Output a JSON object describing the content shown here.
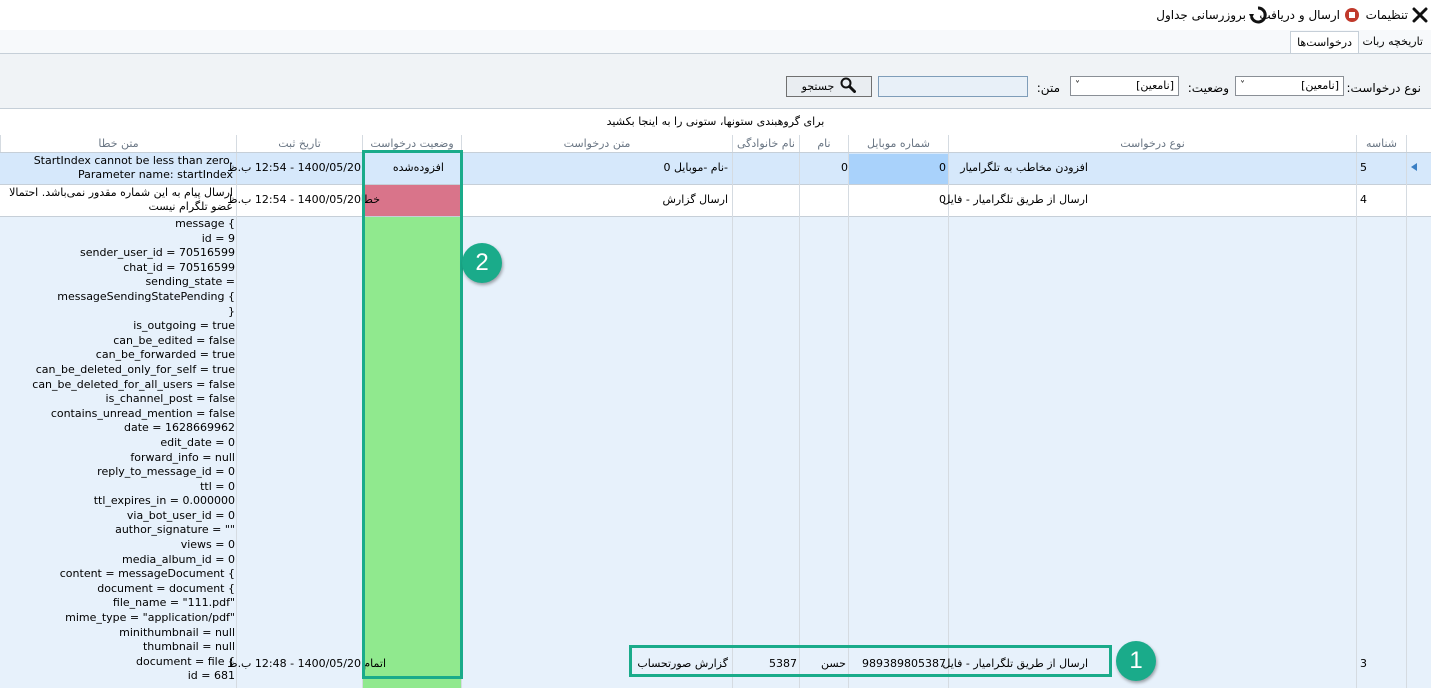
{
  "toolbar": {
    "settings_label": "تنظیمات",
    "send_receive_label": "ارسال و دریافت",
    "refresh_tables_label": "بروزرسانی جداول"
  },
  "tabs": [
    {
      "label": "تاریخچه ربات"
    },
    {
      "label": "درخواست‌ها"
    }
  ],
  "filters": {
    "request_type_label": "نوع درخواست:",
    "request_type_value": "[نامعین]",
    "status_label": "وضعیت:",
    "status_value": "[نامعین]",
    "text_label": "متن:",
    "text_value": "",
    "search_label": "جستجو"
  },
  "grid": {
    "group_hint": "برای گروهبندی ستونها، ستونی را به اینجا بکشید",
    "columns": {
      "id": "شناسه",
      "request_type": "نوع درخواست",
      "mobile": "شماره موبایل",
      "first_name": "نام",
      "last_name": "نام خانوادگی",
      "request_text": "متن درخواست",
      "status": "وضعیت درخواست",
      "created": "تاریخ ثبت",
      "error_text": "متن خطا"
    },
    "rows": [
      {
        "id": "5",
        "request_type": "افزودن مخاطب به تلگرامیار",
        "mobile": "0",
        "first_name": "0",
        "last_name": "",
        "request_text": "-نام  -موبایل 0",
        "status": "افزوده‌شده",
        "created": "1400/05/20 - 12:54 ب.ظ",
        "error_text": "StartIndex cannot be less than zero.\nParameter name: startIndex"
      },
      {
        "id": "4",
        "request_type": "ارسال از طریق تلگرامیار - فایل",
        "mobile": "0",
        "first_name": "",
        "last_name": "",
        "request_text": "ارسال گزارش",
        "status": "خطا",
        "created": "1400/05/20 - 12:54 ب.ظ",
        "error_text": "ارسال پیام به این شماره مقدور نمی‌باشد. احتمالا\nعضو تلگرام نیست"
      },
      {
        "id": "3",
        "request_type": "ارسال از طریق تلگرامیار - فایل",
        "mobile": "989389805387",
        "first_name": "حسن",
        "last_name": "5387",
        "request_text": "گزارش صورتحساب",
        "status": "اتمام",
        "created": "1400/05/20 - 12:48 ب.ظ",
        "error_text": "message {\nid = 9\nsender_user_id = 70516599\nchat_id = 70516599\nsending_state =\nmessageSendingStatePending {\n}\nis_outgoing = true\ncan_be_edited = false\ncan_be_forwarded = true\ncan_be_deleted_only_for_self = true\ncan_be_deleted_for_all_users = false\nis_channel_post = false\ncontains_unread_mention = false\ndate = 1628669962\nedit_date = 0\nforward_info = null\nreply_to_message_id = 0\nttl = 0\nttl_expires_in = 0.000000\nvia_bot_user_id = 0\nauthor_signature = \"\"\nviews = 0\nmedia_album_id = 0\ncontent = messageDocument {\ndocument = document {\nfile_name = \"111.pdf\"\nmime_type = \"application/pdf\"\nminithumbnail = null\nthumbnail = null\ndocument = file {\nid = 681"
      }
    ]
  },
  "callouts": [
    {
      "number": "1"
    },
    {
      "number": "2"
    }
  ],
  "colors": {
    "selected_row": "#d6e8fb",
    "selected_cell": "#a9d2fb",
    "status_error": "#d9748a",
    "status_done": "#90e98e",
    "callout": "#1aab8a"
  }
}
